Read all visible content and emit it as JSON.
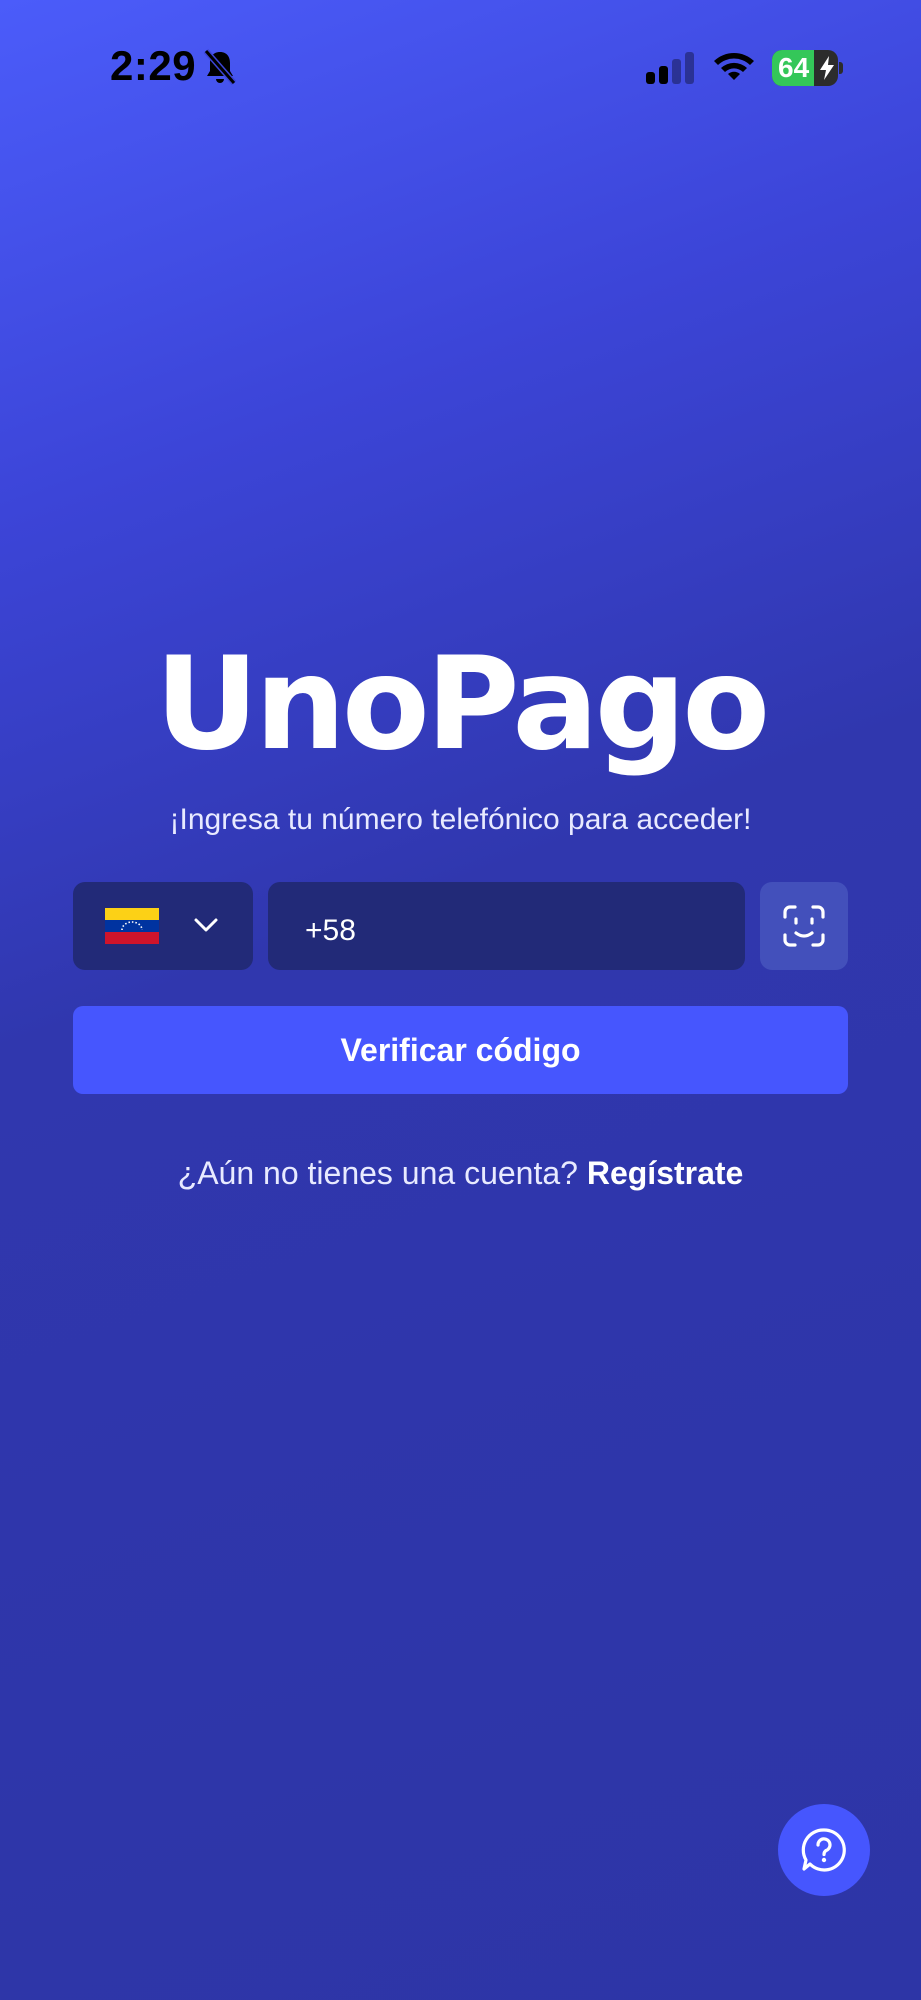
{
  "status_bar": {
    "time": "2:29",
    "battery_level": 64,
    "battery_text": "64",
    "icons": [
      "bell-slash-icon",
      "signal-icon",
      "wifi-icon",
      "battery-charging-icon"
    ]
  },
  "brand": {
    "logo_text": "UnoPago"
  },
  "login": {
    "tagline": "¡Ingresa tu número telefónico para acceder!",
    "country": {
      "flag": "Venezuela",
      "flag_colors": [
        "#fcd116",
        "#0033a0",
        "#cf142b"
      ]
    },
    "phone_prefix": "+58",
    "phone_value": "",
    "verify_button_label": "Verificar código",
    "register_prompt": "¿Aún no tienes una cuenta?",
    "register_link_label": "Regístrate"
  },
  "colors": {
    "primary": "#4656fe",
    "input_bg": "#222a78",
    "background_top": "#4b5cfa",
    "background_bottom": "#2d35a6"
  }
}
